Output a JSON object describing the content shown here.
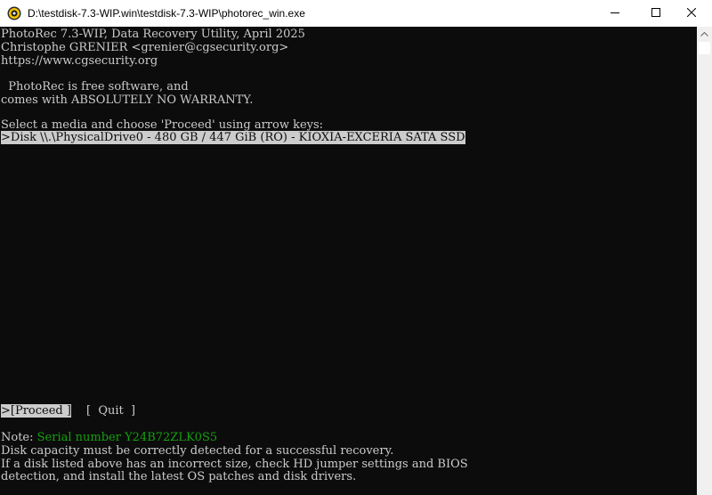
{
  "window": {
    "title": "D:\\testdisk-7.3-WIP.win\\testdisk-7.3-WIP\\photorec_win.exe"
  },
  "console": {
    "header": [
      "PhotoRec 7.3-WIP, Data Recovery Utility, April 2025",
      "Christophe GRENIER <grenier@cgsecurity.org>",
      "https://www.cgsecurity.org"
    ],
    "license": [
      "  PhotoRec is free software, and",
      "comes with ABSOLUTELY NO WARRANTY."
    ],
    "prompt": "Select a media and choose 'Proceed' using arrow keys:",
    "disks": [
      ">Disk \\\\.\\PhysicalDrive0 - 480 GB / 447 GiB (RO) - KIOXIA-EXCERIA SATA SSD"
    ],
    "actions": {
      "proceed": ">[Proceed ]",
      "quit": "[  Quit  ]"
    },
    "note": {
      "label": "Note: ",
      "serial": "Serial number Y24B72ZLK0S5",
      "lines": [
        "Disk capacity must be correctly detected for a successful recovery.",
        "If a disk listed above has an incorrect size, check HD jumper settings and BIOS",
        "detection, and install the latest OS patches and disk drivers."
      ]
    }
  },
  "colors": {
    "background": "#0c0c0c",
    "text": "#cccccc",
    "highlight_bg": "#cccccc",
    "serial": "#13a10e"
  },
  "icons": {
    "app": "photorec-app-icon",
    "minimize": "minimize-icon",
    "maximize": "maximize-icon",
    "close": "close-icon"
  }
}
